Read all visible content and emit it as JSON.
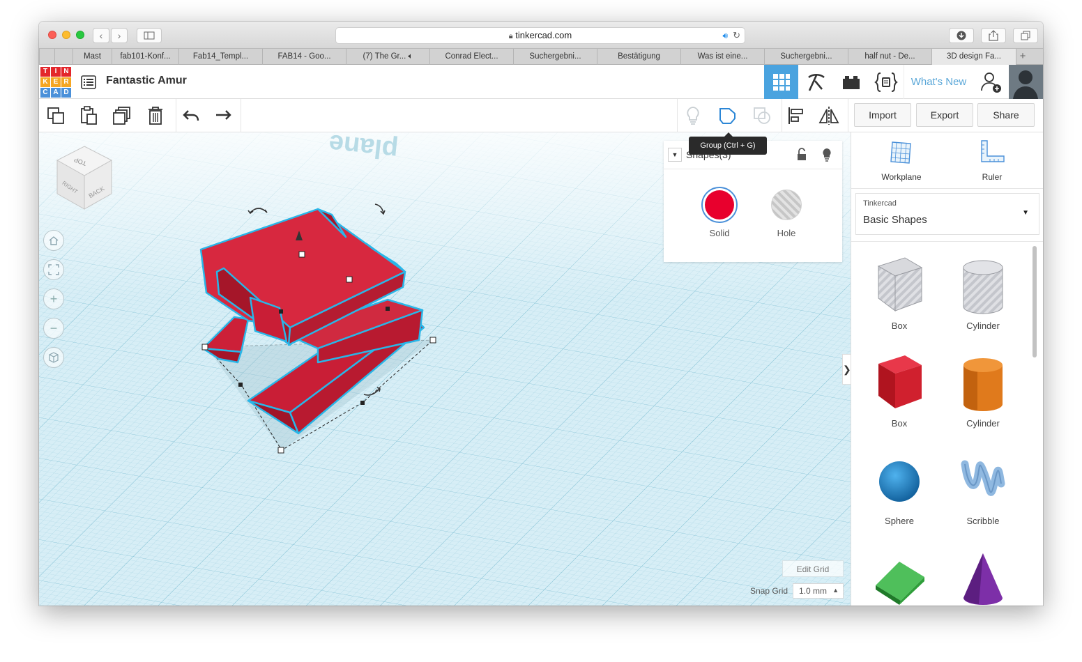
{
  "browser": {
    "url": "tinkercad.com",
    "tabs": [
      "Mast",
      "fab101-Konf...",
      "Fab14_Templ...",
      "FAB14 - Goo...",
      "(7) The Gr...",
      "Conrad Elect...",
      "Suchergebni...",
      "Bestätigung",
      "Was ist eine...",
      "Suchergebni...",
      "half nut - De...",
      "3D design Fa..."
    ],
    "new_tab": "+"
  },
  "app": {
    "logo_letters": [
      "T",
      "I",
      "N",
      "K",
      "E",
      "R",
      "C",
      "A",
      "D"
    ],
    "logo_colors": [
      "#e3262b",
      "#e3262b",
      "#e3262b",
      "#f5a623",
      "#f5a623",
      "#f5a623",
      "#4a90d9",
      "#4a90d9",
      "#4a90d9"
    ],
    "design_name": "Fantastic Amur",
    "whats_new": "What's New",
    "accent": "#1f8ceb"
  },
  "toolbar": {
    "left_icons": [
      "copy-icon",
      "paste-icon",
      "duplicate-icon",
      "delete-icon",
      "undo-icon",
      "redo-icon"
    ],
    "right_icons": [
      "lightbulb-icon",
      "group-icon",
      "ungroup-icon",
      "align-icon",
      "mirror-icon"
    ],
    "import": "Import",
    "export": "Export",
    "share": "Share"
  },
  "tooltip": "Group (Ctrl + G)",
  "inspector": {
    "title": "Shapes(3)",
    "solid": "Solid",
    "hole": "Hole",
    "solid_color": "#e8002d"
  },
  "viewcube": {
    "top": "TOP",
    "right": "RIGHT",
    "back": "BACK"
  },
  "workplane": {
    "watermark": "plane",
    "edit_grid": "Edit Grid",
    "snap_grid_label": "Snap Grid",
    "snap_grid_value": "1.0 mm"
  },
  "rpanel": {
    "workplane": "Workplane",
    "ruler": "Ruler",
    "category_provider": "Tinkercad",
    "category": "Basic Shapes",
    "collapse": "❯",
    "shapes": [
      {
        "label": "Box",
        "color": "#b8b8c0",
        "kind": "box-hole"
      },
      {
        "label": "Cylinder",
        "color": "#b8b8c0",
        "kind": "cyl-hole"
      },
      {
        "label": "Box",
        "color": "#d0202e",
        "kind": "box"
      },
      {
        "label": "Cylinder",
        "color": "#e07a1c",
        "kind": "cyl"
      },
      {
        "label": "Sphere",
        "color": "#1a7fc4",
        "kind": "sphere"
      },
      {
        "label": "Scribble",
        "color": "#8fb8e0",
        "kind": "scribble"
      },
      {
        "label": "",
        "color": "#2f9e3a",
        "kind": "roof"
      },
      {
        "label": "",
        "color": "#7d2fa8",
        "kind": "cone"
      }
    ]
  }
}
